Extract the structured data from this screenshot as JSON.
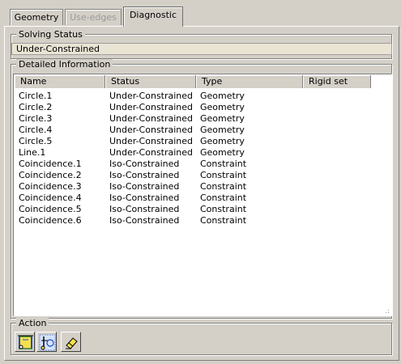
{
  "tabs": [
    {
      "label": "Geometry",
      "state": "normal"
    },
    {
      "label": "Use-edges",
      "state": "disabled"
    },
    {
      "label": "Diagnostic",
      "state": "active"
    }
  ],
  "solving_status": {
    "title": "Solving Status",
    "value": "Under-Constrained"
  },
  "detailed_info": {
    "title": "Detailed Information",
    "columns": [
      "Name",
      "Status",
      "Type",
      "Rigid set"
    ],
    "rows": [
      [
        "Circle.1",
        "Under-Constrained",
        "Geometry"
      ],
      [
        "Circle.2",
        "Under-Constrained",
        "Geometry"
      ],
      [
        "Circle.3",
        "Under-Constrained",
        "Geometry"
      ],
      [
        "Circle.4",
        "Under-Constrained",
        "Geometry"
      ],
      [
        "Circle.5",
        "Under-Constrained",
        "Geometry"
      ],
      [
        "Line.1",
        "Under-Constrained",
        "Geometry"
      ],
      [
        "Coincidence.1",
        "Iso-Constrained",
        "Constraint"
      ],
      [
        "Coincidence.2",
        "Iso-Constrained",
        "Constraint"
      ],
      [
        "Coincidence.3",
        "Iso-Constrained",
        "Constraint"
      ],
      [
        "Coincidence.4",
        "Iso-Constrained",
        "Constraint"
      ],
      [
        "Coincidence.5",
        "Iso-Constrained",
        "Constraint"
      ],
      [
        "Coincidence.6",
        "Iso-Constrained",
        "Constraint"
      ]
    ]
  },
  "action": {
    "title": "Action",
    "buttons": [
      {
        "icon": "fix-together-icon"
      },
      {
        "icon": "deactivate-constraints-icon"
      },
      {
        "icon": "eraser-icon"
      }
    ]
  },
  "colors": {
    "background": "#d4d0c8",
    "status_field": "#eae4d4",
    "list_background": "#ffffff",
    "icon_green": "#2e7d32",
    "icon_blue": "#1e4fb5",
    "icon_yellow": "#f4e04d"
  }
}
